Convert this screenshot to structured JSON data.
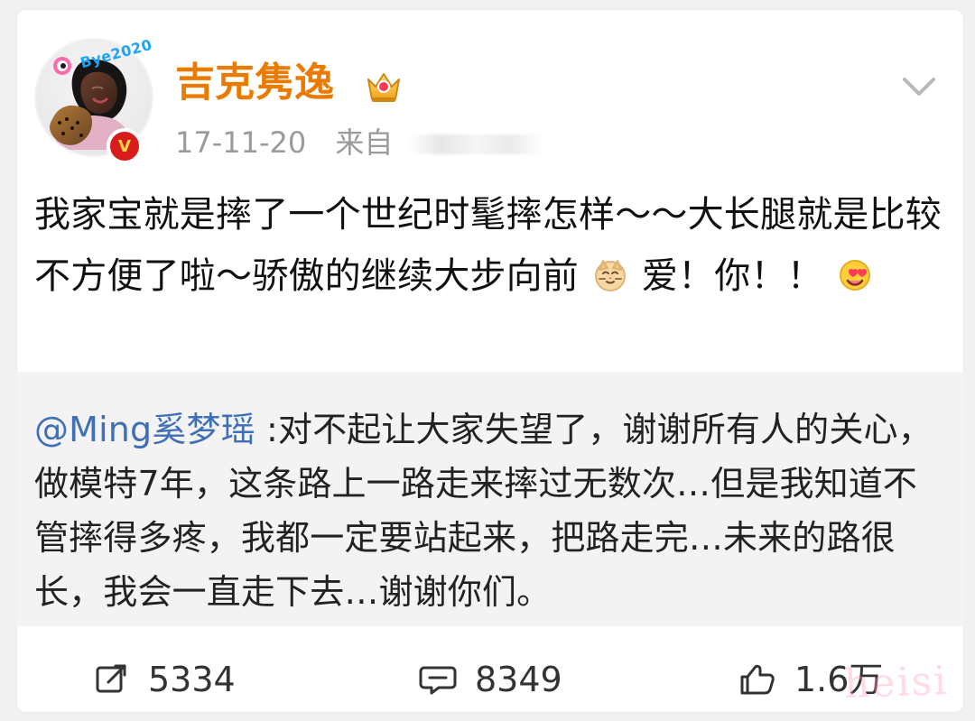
{
  "post": {
    "user": {
      "name": "吉克隽逸",
      "avatar_sticker_text": "Bye2020",
      "vip_badge_text": "V"
    },
    "meta": {
      "time": "17-11-20",
      "source_prefix": "来自"
    },
    "content": {
      "text_part_1": "我家宝就是摔了一个世纪时髦摔怎样～～大长腿就是比较不方便了啦～骄傲的继续大步向前",
      "text_part_2": "爱！你！！"
    }
  },
  "repost": {
    "mention": "@Ming奚梦瑶",
    "text": " :对不起让大家失望了，谢谢所有人的关心，做模特7年，这条路上一路走来摔过无数次…但是我知道不管摔得多疼，我都一定要站起来，把路走完…未来的路很长，我会一直走下去…谢谢你们。"
  },
  "actions": {
    "share_count": "5334",
    "comment_count": "8349",
    "like_count": "1.6万"
  },
  "watermark": {
    "text": "heisi"
  },
  "icons": {
    "share": "share-icon",
    "comment": "comment-icon",
    "like": "thumbs-up-icon",
    "menu": "chevron-down-icon",
    "crown": "crown-icon",
    "emoji_cat": "cat-face-emoji-icon",
    "emoji_heart_eyes": "heart-eyes-emoji-icon",
    "vip": "vip-badge-icon"
  },
  "colors": {
    "username": "#ea7a00",
    "mention": "#3f6fb6",
    "meta": "#9a9a9a",
    "repost_bg": "#f3f3f3",
    "card_bg": "#ffffff",
    "page_bg": "#f1f1f1"
  }
}
